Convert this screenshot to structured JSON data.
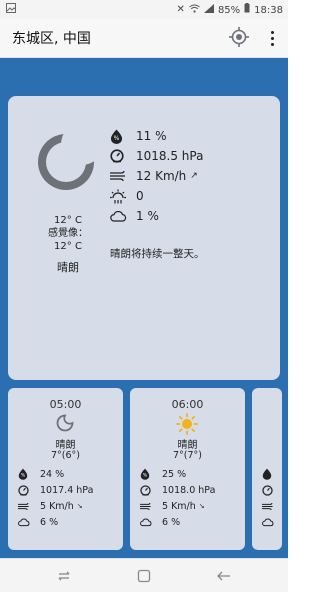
{
  "status_bar": {
    "left_icon": "image-icon",
    "battery": "85%",
    "time": "18:38"
  },
  "app_bar": {
    "title": "东城区, 中国",
    "locate_icon": "gps-locate-icon",
    "menu_icon": "overflow-menu-icon"
  },
  "current": {
    "icon": "moon-icon",
    "temperature": "12° C",
    "feels_like_label": "感覺像：",
    "feels_like": "12° C",
    "condition": "晴朗",
    "humidity": "11 %",
    "pressure": "1018.5 hPa",
    "wind": "12 Km/h",
    "wind_direction_arrow": "↗",
    "uv_index": "0",
    "cloud_cover": "1 %",
    "summary": "晴朗将持续一整天。"
  },
  "hourly": [
    {
      "time": "05:00",
      "icon": "moon-icon",
      "condition": "晴朗",
      "temperature": "7°(6°)",
      "humidity": "24 %",
      "pressure": "1017.4  hPa",
      "wind": "5  Km/h",
      "wind_direction_arrow": "↘",
      "cloud_cover": "6 %"
    },
    {
      "time": "06:00",
      "icon": "sun-icon",
      "condition": "晴朗",
      "temperature": "7°(7°)",
      "humidity": "25 %",
      "pressure": "1018.0  hPa",
      "wind": "5  Km/h",
      "wind_direction_arrow": "↘",
      "cloud_cover": "6 %"
    }
  ],
  "colors": {
    "background_blue": "#2c6fb0",
    "card": "#d6dde9",
    "icon_gray": "#6d7178",
    "sun_yellow": "#f2b418"
  }
}
